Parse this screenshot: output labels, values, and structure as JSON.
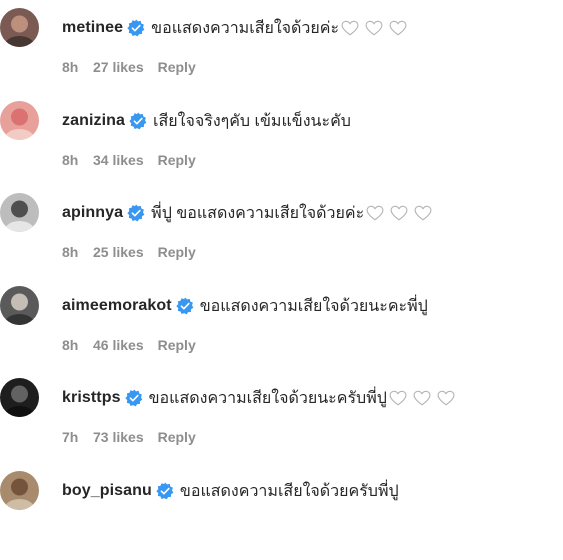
{
  "comments": [
    {
      "username": "metinee",
      "text": "ขอแสดงความเสียใจด้วยค่ะ",
      "hearts": 3,
      "time": "8h",
      "likes": "27 likes",
      "reply": "Reply",
      "avatar_color": "#7a5a52"
    },
    {
      "username": "zanizina",
      "text": "เสียใจจริงๆคับ เข้มแข็งนะคับ",
      "hearts": 0,
      "time": "8h",
      "likes": "34 likes",
      "reply": "Reply",
      "avatar_color": "#e8a09a"
    },
    {
      "username": "apinnya",
      "text": "พี่ปู ขอแสดงความเสียใจด้วยค่ะ",
      "hearts": 3,
      "time": "8h",
      "likes": "25 likes",
      "reply": "Reply",
      "avatar_color": "#bdbdbd"
    },
    {
      "username": "aimeemorakot",
      "text": "ขอแสดงความเสียใจด้วยนะคะพี่ปู",
      "hearts": 0,
      "time": "8h",
      "likes": "46 likes",
      "reply": "Reply",
      "avatar_color": "#5a5a5a"
    },
    {
      "username": "kristtps",
      "text": "ขอแสดงความเสียใจด้วยนะครับพี่ปู",
      "hearts": 3,
      "time": "7h",
      "likes": "73 likes",
      "reply": "Reply",
      "avatar_color": "#1e1e1e"
    },
    {
      "username": "boy_pisanu",
      "text": "ขอแสดงความเสียใจด้วยครับพี่ปู",
      "hearts": 0,
      "time": "",
      "likes": "",
      "reply": "",
      "avatar_color": "#a88a6c"
    }
  ],
  "colors": {
    "verified_badge": "#3897f0",
    "meta_text": "#8e8e8e",
    "primary_text": "#262626",
    "heart_outline": "#b5b5b5"
  },
  "icons": {
    "verified": "verified-badge-icon",
    "heart": "heart-outline-icon"
  }
}
